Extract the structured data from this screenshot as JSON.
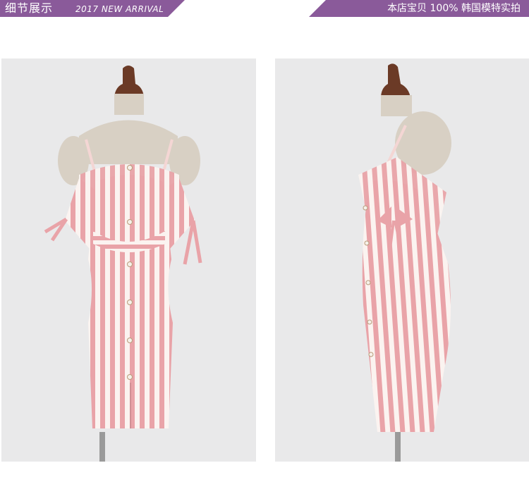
{
  "header": {
    "title_cn": "细节展示",
    "title_en": "2017 NEW ARRIVAL",
    "right_text": "本店宝贝 100% 韩国模特实拍"
  },
  "colors": {
    "header_band": "#8a5a9a",
    "panel_bg": "#e9e9ea",
    "stripe_pink": "#e9a3a8",
    "stripe_white": "#fbf3f0",
    "mannequin_wood": "#6b3a26",
    "mannequin_form": "#d8d0c4"
  },
  "images": [
    {
      "name": "dress-front-photo",
      "description_key": "front"
    },
    {
      "name": "dress-side-photo",
      "description_key": "side"
    }
  ]
}
